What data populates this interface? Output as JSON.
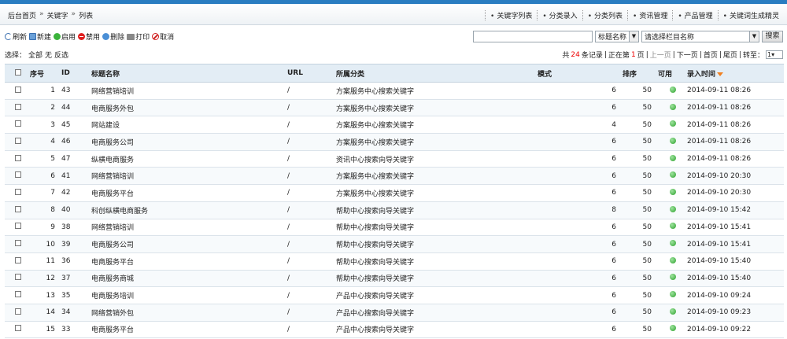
{
  "breadcrumb": [
    "后台首页",
    "关键字",
    "列表"
  ],
  "breadcrumb_sep": "»",
  "quick_links": [
    "关键字列表",
    "分类录入",
    "分类列表",
    "资讯管理",
    "产品管理",
    "关键词生成精灵"
  ],
  "toolbar": {
    "refresh": "刷新",
    "new": "新建",
    "enable": "启用",
    "disable": "禁用",
    "delete": "删除",
    "print": "打印",
    "cancel": "取消"
  },
  "search": {
    "field_select": "标题名称",
    "column_select": "请选择栏目名称",
    "button": "搜索"
  },
  "selection": {
    "label": "选择：",
    "all": "全部",
    "none": "无",
    "invert": "反选"
  },
  "pager": {
    "total_prefix": "共",
    "total": "24",
    "total_suffix": "条记录",
    "current_prefix": "正在第",
    "current": "1",
    "current_suffix": "页",
    "prev": "上一页",
    "next": "下一页",
    "first": "首页",
    "last": "尾页",
    "goto": "转至：",
    "goto_value": "1"
  },
  "colors": {
    "topbar": "#2a7dc1",
    "header_bg": "#e3edf5",
    "enabled": "#2ea22e",
    "highlight": "#e00000"
  },
  "table": {
    "columns": [
      "序号",
      "ID",
      "标题名称",
      "URL",
      "所属分类",
      "模式",
      "排序",
      "可用",
      "录入时间"
    ],
    "rows": [
      {
        "no": "1",
        "id": "43",
        "title": "网络营销培训",
        "url": "/",
        "category": "方案服务中心搜索关键字",
        "mode": "6",
        "order": "50",
        "time": "2014-09-11 08:26"
      },
      {
        "no": "2",
        "id": "44",
        "title": "电商服务外包",
        "url": "/",
        "category": "方案服务中心搜索关键字",
        "mode": "6",
        "order": "50",
        "time": "2014-09-11 08:26"
      },
      {
        "no": "3",
        "id": "45",
        "title": "网站建设",
        "url": "/",
        "category": "方案服务中心搜索关键字",
        "mode": "4",
        "order": "50",
        "time": "2014-09-11 08:26"
      },
      {
        "no": "4",
        "id": "46",
        "title": "电商服务公司",
        "url": "/",
        "category": "方案服务中心搜索关键字",
        "mode": "6",
        "order": "50",
        "time": "2014-09-11 08:26"
      },
      {
        "no": "5",
        "id": "47",
        "title": "纵横电商服务",
        "url": "/",
        "category": "资讯中心搜索向导关键字",
        "mode": "6",
        "order": "50",
        "time": "2014-09-11 08:26"
      },
      {
        "no": "6",
        "id": "41",
        "title": "网络营销培训",
        "url": "/",
        "category": "方案服务中心搜索关键字",
        "mode": "6",
        "order": "50",
        "time": "2014-09-10 20:30"
      },
      {
        "no": "7",
        "id": "42",
        "title": "电商服务平台",
        "url": "/",
        "category": "方案服务中心搜索关键字",
        "mode": "6",
        "order": "50",
        "time": "2014-09-10 20:30"
      },
      {
        "no": "8",
        "id": "40",
        "title": "科创纵横电商服务",
        "url": "/",
        "category": "帮助中心搜索向导关键字",
        "mode": "8",
        "order": "50",
        "time": "2014-09-10 15:42"
      },
      {
        "no": "9",
        "id": "38",
        "title": "网络营销培训",
        "url": "/",
        "category": "帮助中心搜索向导关键字",
        "mode": "6",
        "order": "50",
        "time": "2014-09-10 15:41"
      },
      {
        "no": "10",
        "id": "39",
        "title": "电商服务公司",
        "url": "/",
        "category": "帮助中心搜索向导关键字",
        "mode": "6",
        "order": "50",
        "time": "2014-09-10 15:41"
      },
      {
        "no": "11",
        "id": "36",
        "title": "电商服务平台",
        "url": "/",
        "category": "帮助中心搜索向导关键字",
        "mode": "6",
        "order": "50",
        "time": "2014-09-10 15:40"
      },
      {
        "no": "12",
        "id": "37",
        "title": "电商服务商城",
        "url": "/",
        "category": "帮助中心搜索向导关键字",
        "mode": "6",
        "order": "50",
        "time": "2014-09-10 15:40"
      },
      {
        "no": "13",
        "id": "35",
        "title": "电商服务培训",
        "url": "/",
        "category": "产品中心搜索向导关键字",
        "mode": "6",
        "order": "50",
        "time": "2014-09-10 09:24"
      },
      {
        "no": "14",
        "id": "34",
        "title": "网络营销外包",
        "url": "/",
        "category": "产品中心搜索向导关键字",
        "mode": "6",
        "order": "50",
        "time": "2014-09-10 09:23"
      },
      {
        "no": "15",
        "id": "33",
        "title": "电商服务平台",
        "url": "/",
        "category": "产品中心搜索向导关键字",
        "mode": "6",
        "order": "50",
        "time": "2014-09-10 09:22"
      }
    ]
  }
}
